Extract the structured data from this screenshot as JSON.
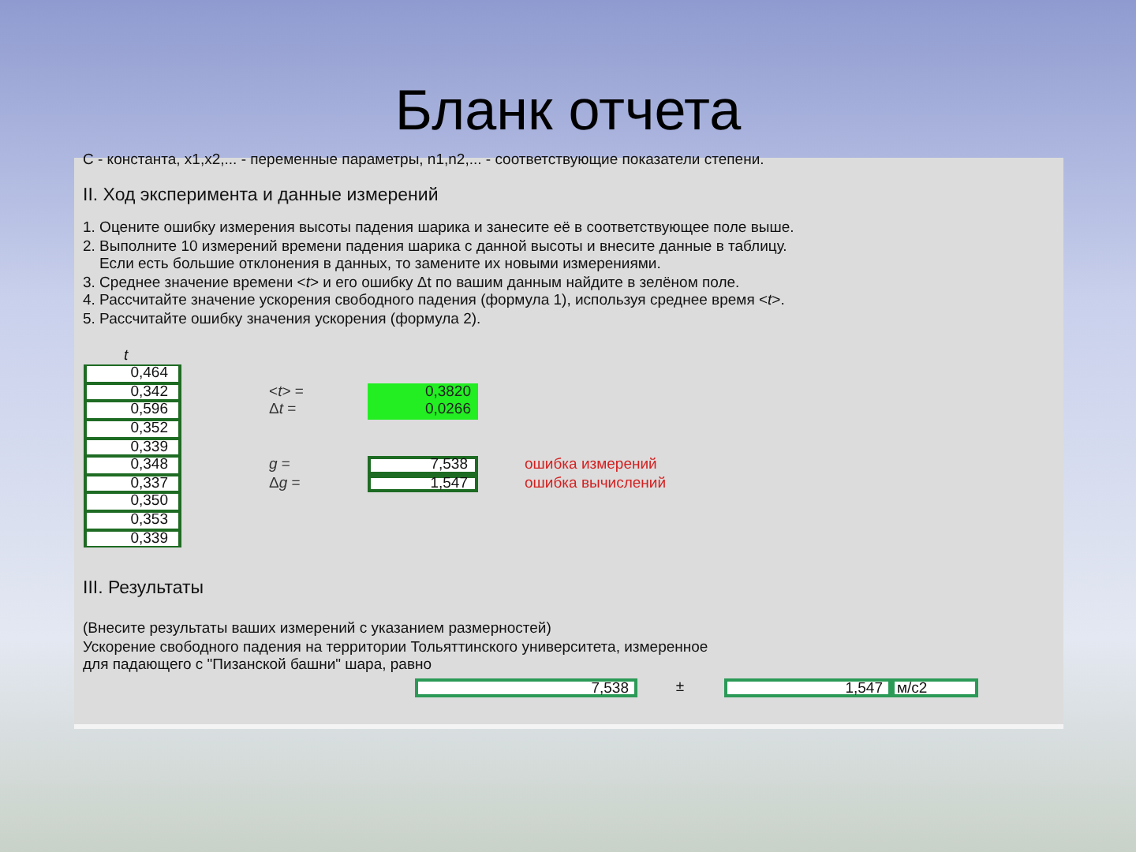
{
  "slide": {
    "title": "Бланк отчета"
  },
  "sheet": {
    "cut_line": "С - константа, x1,x2,... - переменные параметры, n1,n2,... - соответствующие показатели степени.",
    "section_2": {
      "heading": "II. Ход эксперимента и данные измерений",
      "lines": [
        "1. Оцените ошибку измерения высоты падения шарика и занесите её в соответствующее поле выше.",
        "2. Выполните 10 измерений времени падения шарика с данной высоты и внесите данные в таблицу.",
        "    Если есть большие отклонения в данных, то замените их новыми измерениями.",
        "3. Среднее значение времени <*t*> и его ошибку Δt по вашим данным найдите в зелёном поле.",
        "4. Рассчитайте значение ускорения свободного падения (формула 1), используя среднее время <*t*>.",
        "5. Рассчитайте ошибку значения ускорения (формула 2)."
      ]
    },
    "measurements": {
      "header": "t",
      "values": [
        "0,464",
        "0,342",
        "0,596",
        "0,352",
        "0,339",
        "0,348",
        "0,337",
        "0,350",
        "0,353",
        "0,339"
      ]
    },
    "time_stats": [
      {
        "prefix": "<",
        "symbol": "t",
        "suffix": "> =",
        "value": "0,3820"
      },
      {
        "prefix": "Δ",
        "symbol": "t",
        "suffix": " =",
        "value": "0,0266"
      }
    ],
    "acceleration": [
      {
        "symbol": "g",
        "suffix": " =",
        "value": "7,538",
        "note": "ошибка измерений"
      },
      {
        "prefix": "Δ",
        "symbol": "g",
        "suffix": " =",
        "value": "1,547",
        "note": "ошибка вычислений"
      }
    ],
    "section_3": {
      "heading": "III. Результаты",
      "note": "(Внесите результаты ваших измерений с указанием размерностей)",
      "lines": [
        "Ускорение свободного падения на территории Тольяттинского университета, измеренное",
        "для падающего с \"Пизанской башни\" шара, равно"
      ],
      "value": "7,538",
      "plus_minus": "±",
      "error": "1,547",
      "unit": "м/с2"
    }
  }
}
